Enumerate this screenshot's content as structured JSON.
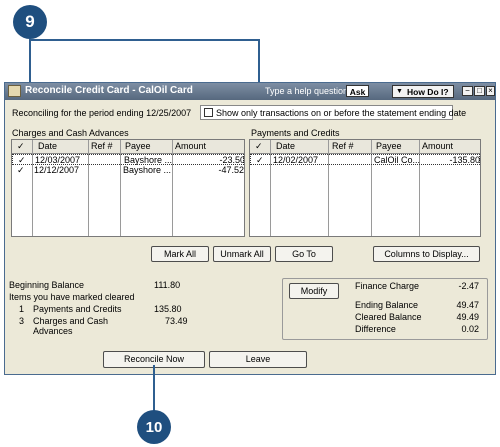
{
  "callouts": {
    "top": "9",
    "bottom": "10"
  },
  "window": {
    "title": "Reconcile Credit Card - CalOil Card",
    "help_label": "Type a help question",
    "ask_label": "Ask",
    "howdoi_label": "How Do I?",
    "minimize_glyph": "−",
    "restore_glyph": "□",
    "close_glyph": "×"
  },
  "period_text": "Reconciling for the period ending 12/25/2007",
  "show_only_label": "Show only transactions on or before the statement ending date",
  "charges": {
    "section_label": "Charges and Cash Advances",
    "headers": {
      "check": "✓",
      "date": "Date",
      "ref": "Ref #",
      "payee": "Payee",
      "amount": "Amount"
    },
    "rows": [
      {
        "check": "✓",
        "date": "12/03/2007",
        "ref": "",
        "payee": "Bayshore ...",
        "amount": "-23.50"
      },
      {
        "check": "✓",
        "date": "12/12/2007",
        "ref": "",
        "payee": "Bayshore ...",
        "amount": "-47.52"
      }
    ]
  },
  "payments": {
    "section_label": "Payments and Credits",
    "headers": {
      "check": "✓",
      "date": "Date",
      "ref": "Ref #",
      "payee": "Payee",
      "amount": "Amount"
    },
    "rows": [
      {
        "check": "✓",
        "date": "12/02/2007",
        "ref": "",
        "payee": "CalOil Co...",
        "amount": "-135.80"
      }
    ]
  },
  "buttons": {
    "mark_all": "Mark All",
    "unmark_all": "Unmark All",
    "go_to": "Go To",
    "columns": "Columns to Display...",
    "modify": "Modify",
    "reconcile_now": "Reconcile Now",
    "leave": "Leave"
  },
  "summary": {
    "beginning_balance_label": "Beginning Balance",
    "beginning_balance_value": "111.80",
    "marked_cleared_label": "Items you have marked cleared",
    "payments_count": "1",
    "payments_label": "Payments and Credits",
    "payments_value": "135.80",
    "charges_count": "3",
    "charges_label_1": "Charges and Cash",
    "charges_label_2": "Advances",
    "charges_value": "73.49"
  },
  "totals": {
    "finance_charge_label": "Finance Charge",
    "finance_charge_value": "-2.47",
    "ending_balance_label": "Ending Balance",
    "ending_balance_value": "49.47",
    "cleared_balance_label": "Cleared Balance",
    "cleared_balance_value": "49.49",
    "difference_label": "Difference",
    "difference_value": "0.02"
  }
}
